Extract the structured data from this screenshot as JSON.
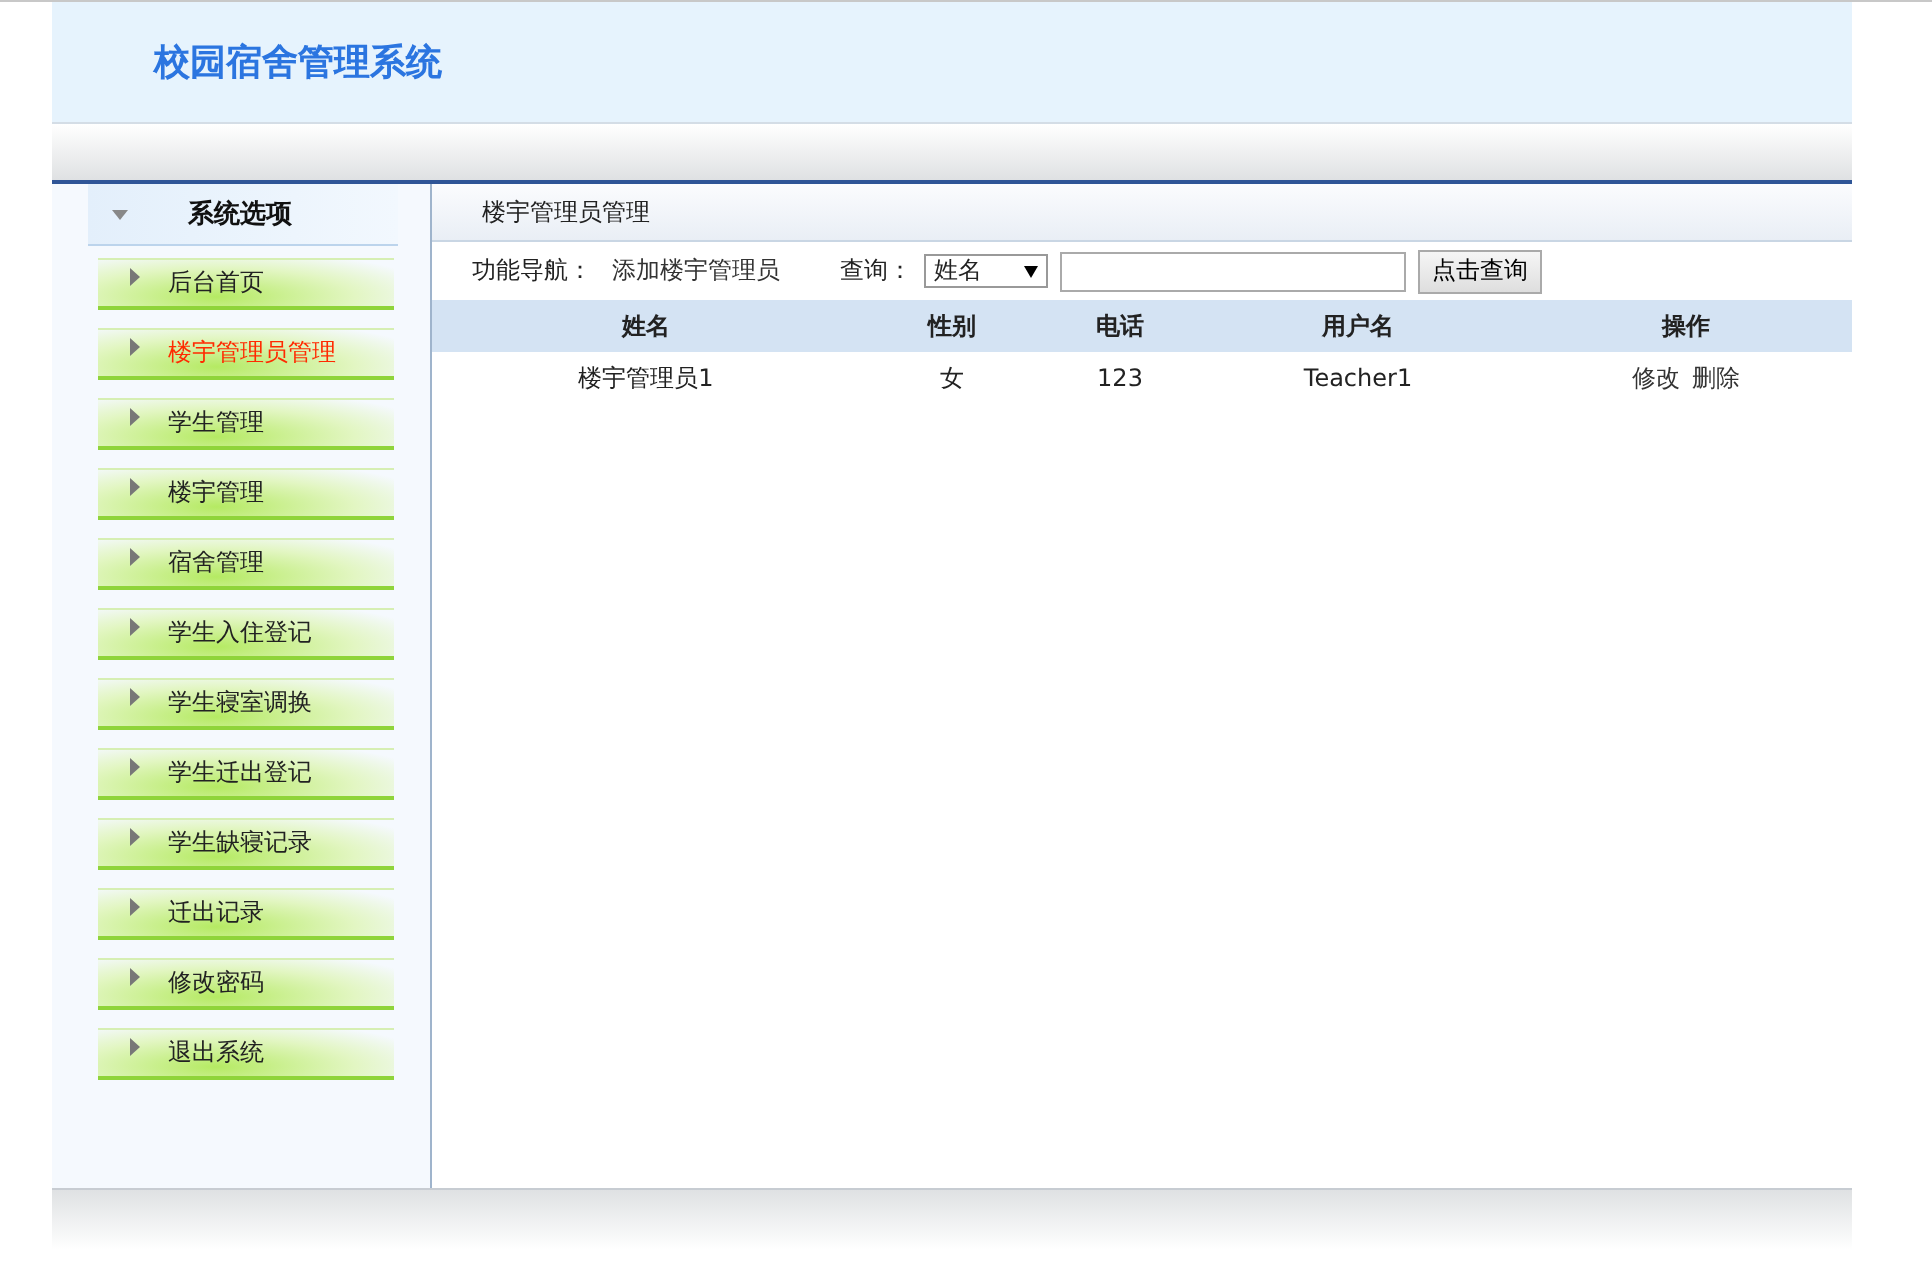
{
  "header": {
    "title": "校园宿舍管理系统"
  },
  "sidebar": {
    "title": "系统选项",
    "items": [
      {
        "label": "后台首页",
        "selected": false
      },
      {
        "label": "楼宇管理员管理",
        "selected": true
      },
      {
        "label": "学生管理",
        "selected": false
      },
      {
        "label": "楼宇管理",
        "selected": false
      },
      {
        "label": "宿舍管理",
        "selected": false
      },
      {
        "label": "学生入住登记",
        "selected": false
      },
      {
        "label": "学生寝室调换",
        "selected": false
      },
      {
        "label": "学生迁出登记",
        "selected": false
      },
      {
        "label": "学生缺寝记录",
        "selected": false
      },
      {
        "label": "迁出记录",
        "selected": false
      },
      {
        "label": "修改密码",
        "selected": false
      },
      {
        "label": "退出系统",
        "selected": false
      }
    ]
  },
  "content": {
    "title": "楼宇管理员管理",
    "nav_label": "功能导航：",
    "nav_link": "添加楼宇管理员",
    "query_label": "查询：",
    "query_select": "姓名",
    "query_button": "点击查询"
  },
  "table": {
    "columns": [
      "姓名",
      "性别",
      "电话",
      "用户名",
      "操作"
    ],
    "rows": [
      {
        "cells": [
          "楼宇管理员1",
          "女",
          "123",
          "Teacher1"
        ],
        "actions": [
          "修改",
          "删除"
        ]
      }
    ]
  }
}
